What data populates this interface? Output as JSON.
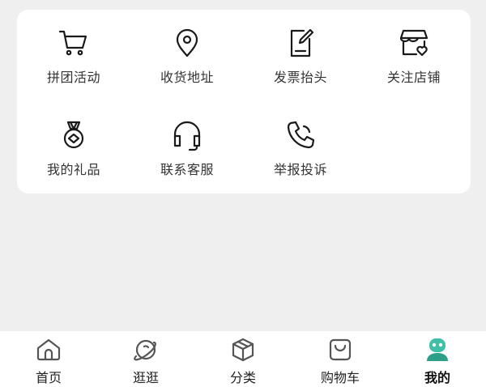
{
  "colors": {
    "background": "#efefef",
    "card": "#ffffff",
    "icon_stroke": "#1a1a1a",
    "tab_icon_stroke": "#555555",
    "accent": "#3ebfa6",
    "accent_dark": "#2d9e88"
  },
  "services": [
    {
      "label": "拼团活动",
      "icon": "cart-icon"
    },
    {
      "label": "收货地址",
      "icon": "location-pin-icon"
    },
    {
      "label": "发票抬头",
      "icon": "invoice-icon"
    },
    {
      "label": "关注店铺",
      "icon": "store-icon"
    },
    {
      "label": "我的礼品",
      "icon": "medal-icon"
    },
    {
      "label": "联系客服",
      "icon": "headset-icon"
    },
    {
      "label": "举报投诉",
      "icon": "phone-icon"
    }
  ],
  "tabbar": {
    "items": [
      {
        "label": "首页",
        "icon": "home-icon",
        "active": false
      },
      {
        "label": "逛逛",
        "icon": "planet-icon",
        "active": false
      },
      {
        "label": "分类",
        "icon": "cube-icon",
        "active": false
      },
      {
        "label": "购物车",
        "icon": "bag-icon",
        "active": false
      },
      {
        "label": "我的",
        "icon": "user-icon",
        "active": true
      }
    ]
  }
}
